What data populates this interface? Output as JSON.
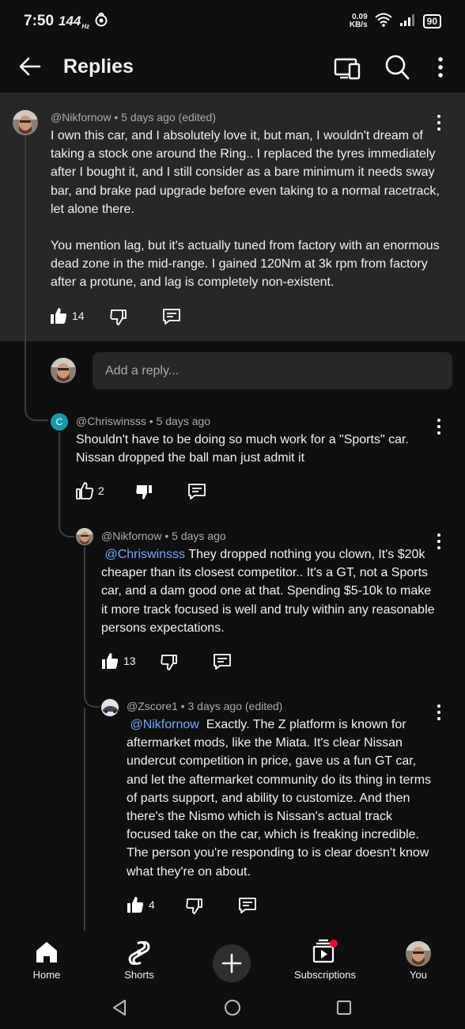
{
  "status_bar": {
    "time": "7:50",
    "refresh_rate": "144",
    "refresh_unit": "Hz",
    "net_speed_value": "0.09",
    "net_speed_unit": "KB/s",
    "battery": "90"
  },
  "header": {
    "title": "Replies",
    "icons": [
      "back-arrow-icon",
      "cast-icon",
      "search-icon",
      "more-vertical-icon"
    ]
  },
  "comments": [
    {
      "author": "@Nikfornow",
      "time": "5 days ago (edited)",
      "paragraphs": [
        "I own this car, and I absolutely love it, but man, I wouldn't dream of taking a stock one around the Ring.. I replaced the tyres immediately after I bought it, and I still consider as a bare minimum it needs sway bar, and brake pad upgrade before even taking to a normal racetrack, let alone there.",
        "You mention lag, but it's actually tuned from factory with an enormous dead zone in the mid-range. I gained 120Nm at 3k rpm from factory after a protune, and lag is completely non-existent."
      ],
      "likes": "14"
    },
    {
      "author": "@Chriswinsss",
      "avatar_letter": "C",
      "time": "5 days ago",
      "text": "Shouldn't have to be doing so much work for a \"Sports\" car. Nissan dropped the ball man just admit it",
      "likes": "2"
    },
    {
      "author": "@Nikfornow",
      "time": "5 days ago",
      "mention": "@Chriswinsss",
      "text": "They dropped nothing you clown, It's $20k cheaper than its closest competitor.. It's a GT, not a Sports car, and a dam good one at that. Spending $5-10k to make it more track focused is well and truly within any reasonable persons expectations.",
      "likes": "13"
    },
    {
      "author": "@Zscore1",
      "time": "3 days ago (edited)",
      "mention": "@Nikfornow",
      "text": "Exactly. The Z platform is known for aftermarket mods, like the Miata. It's clear Nissan undercut competition in price, gave us a fun GT car, and let the aftermarket community do its thing in terms of parts support, and ability to customize. And then there's the Nismo which is Nissan's actual track focused take on the car, which is freaking incredible. The person you're responding to is clear doesn't know what they're on about.",
      "likes": "4"
    }
  ],
  "reply_box": {
    "placeholder": "Add a reply..."
  },
  "bottom_nav": [
    {
      "label": "Home",
      "icon": "home-icon"
    },
    {
      "label": "Shorts",
      "icon": "shorts-icon"
    },
    {
      "label": "",
      "icon": "plus-icon"
    },
    {
      "label": "Subscriptions",
      "icon": "subscriptions-icon"
    },
    {
      "label": "You",
      "icon": "avatar"
    }
  ],
  "colors": {
    "background": "#0f0f0f",
    "highlight": "#272727",
    "mention": "#6aa8ff",
    "notification_dot": "#ff0033",
    "avatar_c": "#1b9aaa"
  }
}
